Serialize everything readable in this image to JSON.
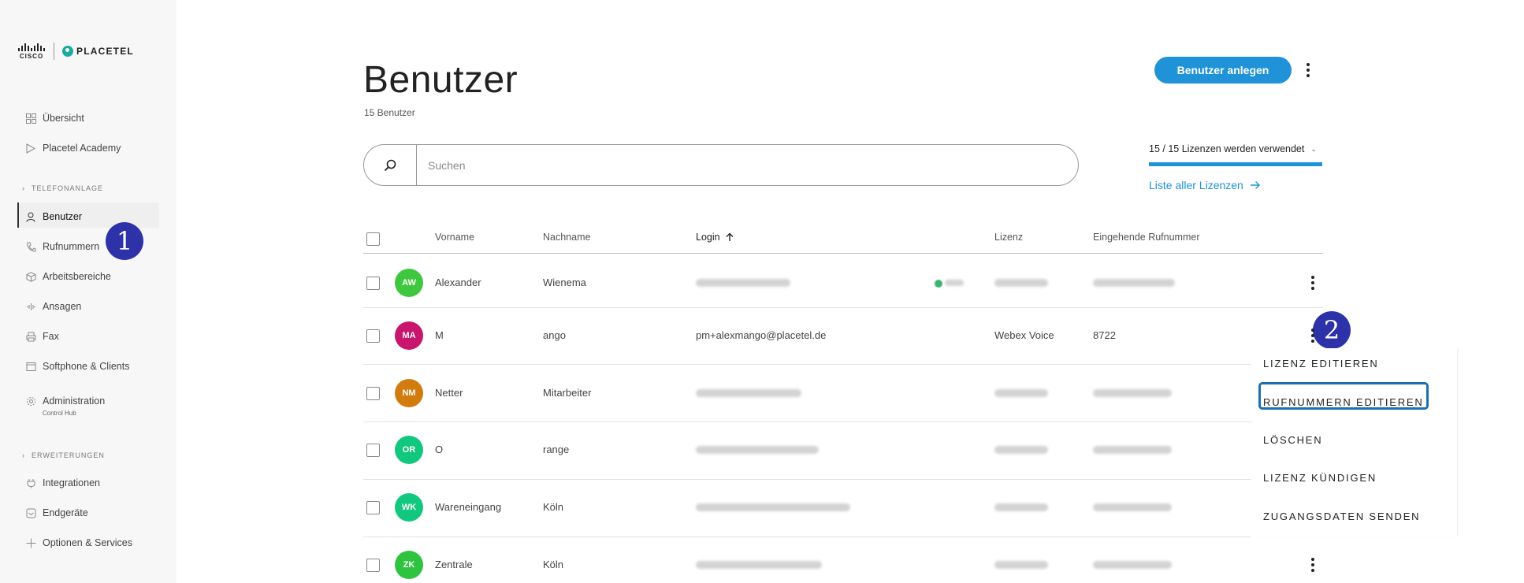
{
  "brand": {
    "cisco_text": "CISCO",
    "placetel_text": "PLACETEL"
  },
  "sidebar": {
    "items_top": [
      {
        "label": "Übersicht",
        "icon": "grid-icon"
      },
      {
        "label": "Placetel Academy",
        "icon": "play-icon"
      }
    ],
    "section_telefonanlage": "TELEFONANLAGE",
    "items_phone": [
      {
        "label": "Benutzer",
        "icon": "user-icon",
        "active": true
      },
      {
        "label": "Rufnummern",
        "icon": "phone-icon"
      },
      {
        "label": "Arbeitsbereiche",
        "icon": "cube-icon"
      },
      {
        "label": "Ansagen",
        "icon": "sound-wave-icon"
      },
      {
        "label": "Fax",
        "icon": "printer-icon"
      },
      {
        "label": "Softphone & Clients",
        "icon": "window-icon"
      },
      {
        "label": "Administration",
        "icon": "gear-icon",
        "sub": "Control Hub"
      }
    ],
    "section_erweiterungen": "ERWEITERUNGEN",
    "items_ext": [
      {
        "label": "Integrationen",
        "icon": "plug-icon"
      },
      {
        "label": "Endgeräte",
        "icon": "device-icon"
      },
      {
        "label": "Optionen & Services",
        "icon": "plus-icon"
      }
    ]
  },
  "annotations": {
    "step1": "1",
    "step2": "2"
  },
  "page": {
    "title": "Benutzer",
    "subtitle": "15 Benutzer",
    "create_button": "Benutzer anlegen"
  },
  "search": {
    "placeholder": "Suchen"
  },
  "license": {
    "usage_text": "15 / 15 Lizenzen werden verwendet",
    "usage_fraction": 1.0,
    "list_link": "Liste aller Lizenzen"
  },
  "table": {
    "headers": {
      "firstname": "Vorname",
      "lastname": "Nachname",
      "login": "Login",
      "license": "Lizenz",
      "incoming": "Eingehende Rufnummer"
    },
    "rows": [
      {
        "initials": "AW",
        "color": "#3fc83f",
        "firstname": "Alexander",
        "lastname": "Wienema",
        "login": "",
        "license": "",
        "number": ""
      },
      {
        "initials": "MA",
        "color": "#c8156e",
        "firstname": "M",
        "lastname": "ango",
        "login": "pm+alexmango@placetel.de",
        "license": "Webex Voice",
        "number": "8722"
      },
      {
        "initials": "NM",
        "color": "#d27b0f",
        "firstname": "Netter",
        "lastname": "Mitarbeiter",
        "login": "",
        "license": "",
        "number": ""
      },
      {
        "initials": "OR",
        "color": "#12c77e",
        "firstname": "O",
        "lastname": "range",
        "login": "",
        "license": "",
        "number": ""
      },
      {
        "initials": "WK",
        "color": "#12c77e",
        "firstname": "Wareneingang",
        "lastname": "Köln",
        "login": "",
        "license": "",
        "number": ""
      },
      {
        "initials": "ZK",
        "color": "#2fc43f",
        "firstname": "Zentrale",
        "lastname": "Köln",
        "login": "",
        "license": "",
        "number": ""
      }
    ]
  },
  "context_menu": {
    "items": [
      "LIZENZ EDITIEREN",
      "RUFNUMMERN EDITIEREN",
      "LÖSCHEN",
      "LIZENZ KÜNDIGEN",
      "ZUGANGSDATEN SENDEN"
    ]
  },
  "colors": {
    "accent": "#1f92d8",
    "annotation": "#2e32a8",
    "focus": "#1b6fb0"
  }
}
